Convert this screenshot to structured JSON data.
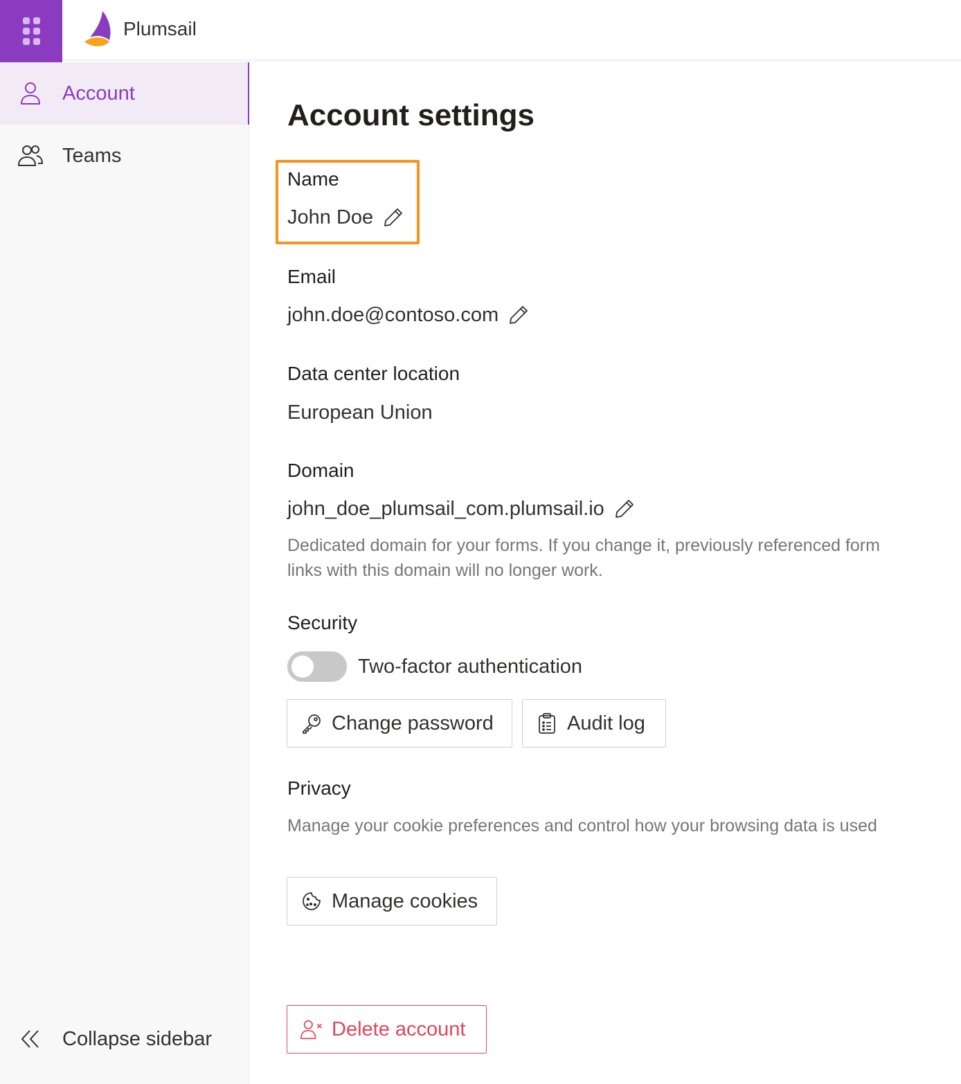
{
  "header": {
    "brand": "Plumsail",
    "waffle_icon": "app-launcher-icon",
    "accent_color": "#8a3bc0"
  },
  "sidebar": {
    "items": [
      {
        "label": "Account",
        "icon": "person-icon",
        "active": true
      },
      {
        "label": "Teams",
        "icon": "people-icon",
        "active": false
      }
    ],
    "collapse_label": "Collapse sidebar"
  },
  "main": {
    "title": "Account settings",
    "name": {
      "label": "Name",
      "value": "John Doe"
    },
    "email": {
      "label": "Email",
      "value": "john.doe@contoso.com"
    },
    "data_center": {
      "label": "Data center location",
      "value": "European Union"
    },
    "domain": {
      "label": "Domain",
      "value": "john_doe_plumsail_com.plumsail.io",
      "help": "Dedicated domain for your forms. If you change it, previously referenced form links with this domain will no longer work."
    },
    "security": {
      "label": "Security",
      "two_factor_label": "Two-factor authentication",
      "two_factor_enabled": false,
      "change_password_label": "Change password",
      "audit_log_label": "Audit log"
    },
    "privacy": {
      "label": "Privacy",
      "help": "Manage your cookie preferences and control how your browsing data is used",
      "manage_cookies_label": "Manage cookies"
    },
    "delete_account_label": "Delete account",
    "highlight_color": "#f7941d",
    "danger_color": "#e0465e"
  }
}
